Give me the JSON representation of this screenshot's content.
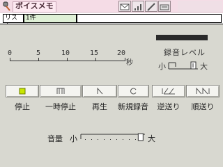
{
  "app": {
    "title": "ボイスメモ"
  },
  "tabs": {
    "list_label": "リスト",
    "count_label": "1件",
    "field_value": ""
  },
  "timeline": {
    "ticks": [
      "0",
      "5",
      "10",
      "15",
      "20"
    ],
    "unit": "秒"
  },
  "rec_level": {
    "label": "録音レベル",
    "min_label": "小",
    "max_label": "大",
    "level": 0.0
  },
  "controls": {
    "stop": "停止",
    "pause": "一時停止",
    "play": "再生",
    "new_record": "新規録音",
    "rewind": "逆送り",
    "forward": "順送り"
  },
  "volume": {
    "label": "音量",
    "min_label": "小",
    "max_label": "大",
    "level": 0.98
  },
  "colors": {
    "titlebar": "#f5dce6",
    "panel": "#d8d8d0",
    "stop_accent": "#c8e600"
  }
}
